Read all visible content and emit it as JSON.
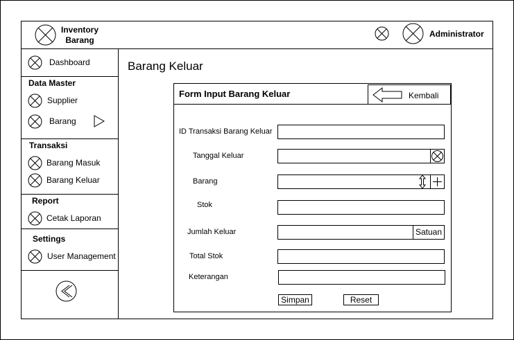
{
  "app": {
    "title_line1": "Inventory",
    "title_line2": "Barang",
    "user": "Administrator"
  },
  "sidebar": {
    "dashboard": "Dashboard",
    "sections": [
      {
        "title": "Data Master",
        "items": [
          "Supplier",
          "Barang"
        ]
      },
      {
        "title": "Transaksi",
        "items": [
          "Barang Masuk",
          "Barang Keluar"
        ]
      },
      {
        "title": "Report",
        "items": [
          "Cetak Laporan"
        ]
      },
      {
        "title": "Settings",
        "items": [
          "User Management"
        ]
      }
    ]
  },
  "page": {
    "title": "Barang Keluar"
  },
  "form": {
    "title": "Form  Input Barang Keluar",
    "back_label": "Kembali",
    "fields": {
      "id_transaksi": "ID Transaksi Barang Keluar",
      "tanggal": "Tanggal Keluar",
      "barang": "Barang",
      "stok": "Stok",
      "jumlah": "Jumlah Keluar",
      "satuan": "Satuan",
      "total_stok": "Total Stok",
      "keterangan": "Keterangan"
    },
    "save_label": "Simpan",
    "reset_label": "Reset"
  }
}
